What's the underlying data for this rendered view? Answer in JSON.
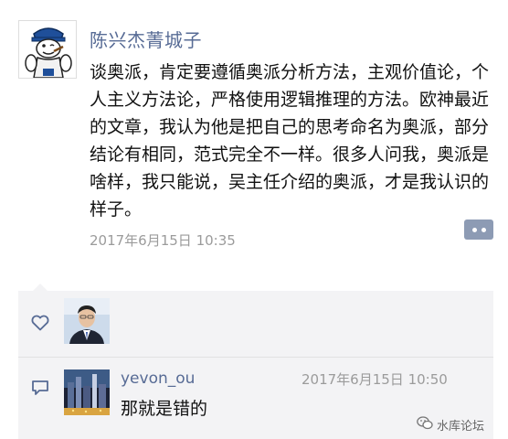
{
  "post": {
    "author": "陈兴杰菁城子",
    "body": "谈奥派，肯定要遵循奥派分析方法，主观价值论，个人主义方法论，严格使用逻辑推理的方法。欧神最近的文章，我认为他是把自己的思考命名为奥派，部分结论有相同，范式完全不一样。很多人问我，奥派是啥样，我只能说，吴主任介绍的奥派，才是我认识的样子。",
    "time": "2017年6月15日 10:35"
  },
  "interactions": {
    "comment": {
      "name": "yevon_ou",
      "time": "2017年6月15日 10:50",
      "text": "那就是错的"
    }
  },
  "watermark": {
    "text": "水库论坛"
  },
  "icons": {
    "like": "heart-outline-icon",
    "comment": "comment-bubble-icon",
    "more": "more-dots-icon",
    "watermark": "wechat-icon"
  },
  "colors": {
    "name_link": "#576b95",
    "time_gray": "#9b9b9b",
    "interaction_bg": "#f3f3f5",
    "more_button": "#8d9bb4"
  }
}
